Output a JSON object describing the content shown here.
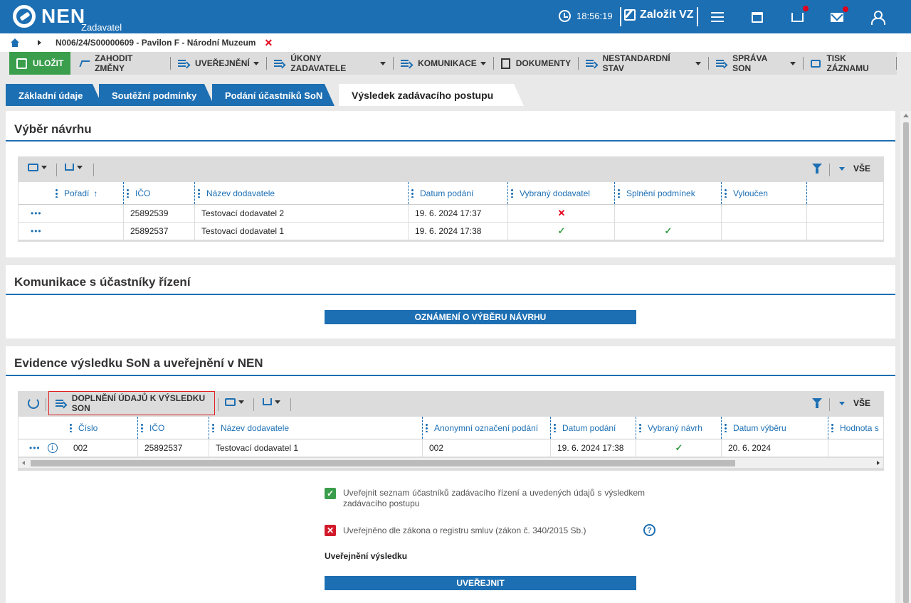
{
  "header": {
    "logo": "NEN",
    "role": "Zadavatel",
    "time": "18:56:19",
    "create_label": "Založit VZ"
  },
  "breadcrumb": {
    "record": "N006/24/S00000609 - Pavilon F - Národní Muzeum",
    "close": "✕"
  },
  "toolbar": {
    "save": "ULOŽIT",
    "discard": "ZAHODIT ZMĚNY",
    "publish": "UVEŘEJNĚNÍ",
    "acts": "ÚKONY ZADAVATELE",
    "communication": "KOMUNIKACE",
    "documents": "DOKUMENTY",
    "nonstandard": "NESTANDARDNÍ STAV",
    "manage": "SPRÁVA SON",
    "print": "TISK ZÁZNAMU"
  },
  "tabs": [
    {
      "label": "Základní údaje"
    },
    {
      "label": "Soutěžní podmínky"
    },
    {
      "label": "Podání účastníků SoN"
    },
    {
      "label": "Výsledek zadávacího postupu"
    }
  ],
  "section1": {
    "title": "Výběr návrhu",
    "all": "VŠE",
    "columns": [
      "Pořadí",
      "IČO",
      "Název dodavatele",
      "Datum podání",
      "Vybraný dodavatel",
      "Splnění podmínek",
      "Vyloučen"
    ],
    "sort_arrow": "↑",
    "rows": [
      {
        "menu": "•••",
        "ico": "25892539",
        "name": "Testovací dodavatel 2",
        "date": "19. 6. 2024 17:37",
        "selected": "✕",
        "fulfilled": ""
      },
      {
        "menu": "•••",
        "ico": "25892537",
        "name": "Testovací dodavatel 1",
        "date": "19. 6. 2024 17:38",
        "selected": "✓",
        "fulfilled": "✓"
      }
    ]
  },
  "section2": {
    "title": "Komunikace s účastníky řízení",
    "button": "OZNÁMENÍ O VÝBĚRU NÁVRHU"
  },
  "section3": {
    "title": "Evidence výsledku SoN a uveřejnění v NEN",
    "add_button": "DOPLNĚNÍ ÚDAJŮ K VÝSLEDKU SON",
    "all": "VŠE",
    "columns": [
      "Číslo",
      "IČO",
      "Název dodavatele",
      "Anonymní označení podání",
      "Datum podání",
      "Vybraný návrh",
      "Datum výběru",
      "Hodnota s"
    ],
    "rows": [
      {
        "menu": "•••",
        "info": "i",
        "number": "002",
        "ico": "25892537",
        "name": "Testovací dodavatel 1",
        "anon": "002",
        "date": "19. 6. 2024 17:38",
        "selected": "✓",
        "select_date": "20. 6. 2024"
      }
    ],
    "checkbox1": "Uveřejnit seznam účastníků zadávacího řízení a uvedených údajů s výsledkem zadávacího postupu",
    "checkbox1_mark": "✓",
    "checkbox2": "Uveřejněno dle zákona o registru smluv (zákon č. 340/2015 Sb.)",
    "checkbox2_mark": "✕",
    "help": "?",
    "publish_label": "Uveřejnění výsledku",
    "publish_button": "UVEŘEJNIT"
  },
  "colors": {
    "primary": "#1d6fb3",
    "success": "#3a9e4c",
    "danger": "#e2001a"
  }
}
